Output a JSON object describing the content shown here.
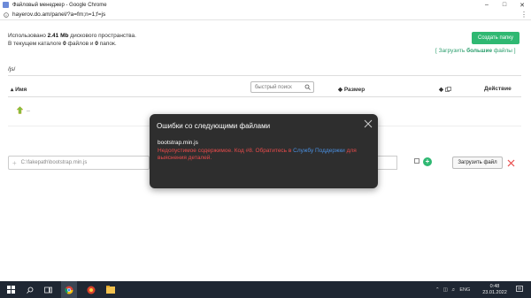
{
  "window": {
    "title": "Файловый менеджер - Google Chrome",
    "url": "hayerov.do.am/panel/?a=fm;n=1;f=js"
  },
  "usage": {
    "line1_prefix": "Использовано ",
    "used": "2.41 Mb",
    "line1_suffix": " дискового пространства.",
    "line2_prefix": "В текущем каталоге ",
    "files": "0",
    "line2_mid": " файлов и ",
    "folders": "0",
    "line2_suffix": " папок."
  },
  "actions": {
    "create_folder": "Создать папку",
    "upload_prefix": "[ Загрузить ",
    "upload_bold": "большие",
    "upload_suffix": " файлы ]"
  },
  "path": "/js/",
  "table": {
    "col_name": "Имя",
    "col_size": "Размер",
    "col_action": "Действие",
    "search_placeholder": "быстрый поиск",
    "parent_label": ".."
  },
  "upload": {
    "file_value": "C:\\fakepath\\bootstrap.min.js",
    "button": "Загрузить файл"
  },
  "modal": {
    "title": "Ошибки со следующими файлами",
    "filename": "bootstrap.min.js",
    "error_text": "Недопустимое содержимое. Код #8. Обратитесь в ",
    "link1": "Службу Поддержки",
    "error_suffix": " для выяснения деталей."
  },
  "taskbar": {
    "lang": "ENG",
    "time": "0:48",
    "date": "23.01.2022"
  },
  "colors": {
    "accent_green": "#2fb872",
    "error_red": "#e94b4b",
    "link_blue": "#4a90e2"
  }
}
